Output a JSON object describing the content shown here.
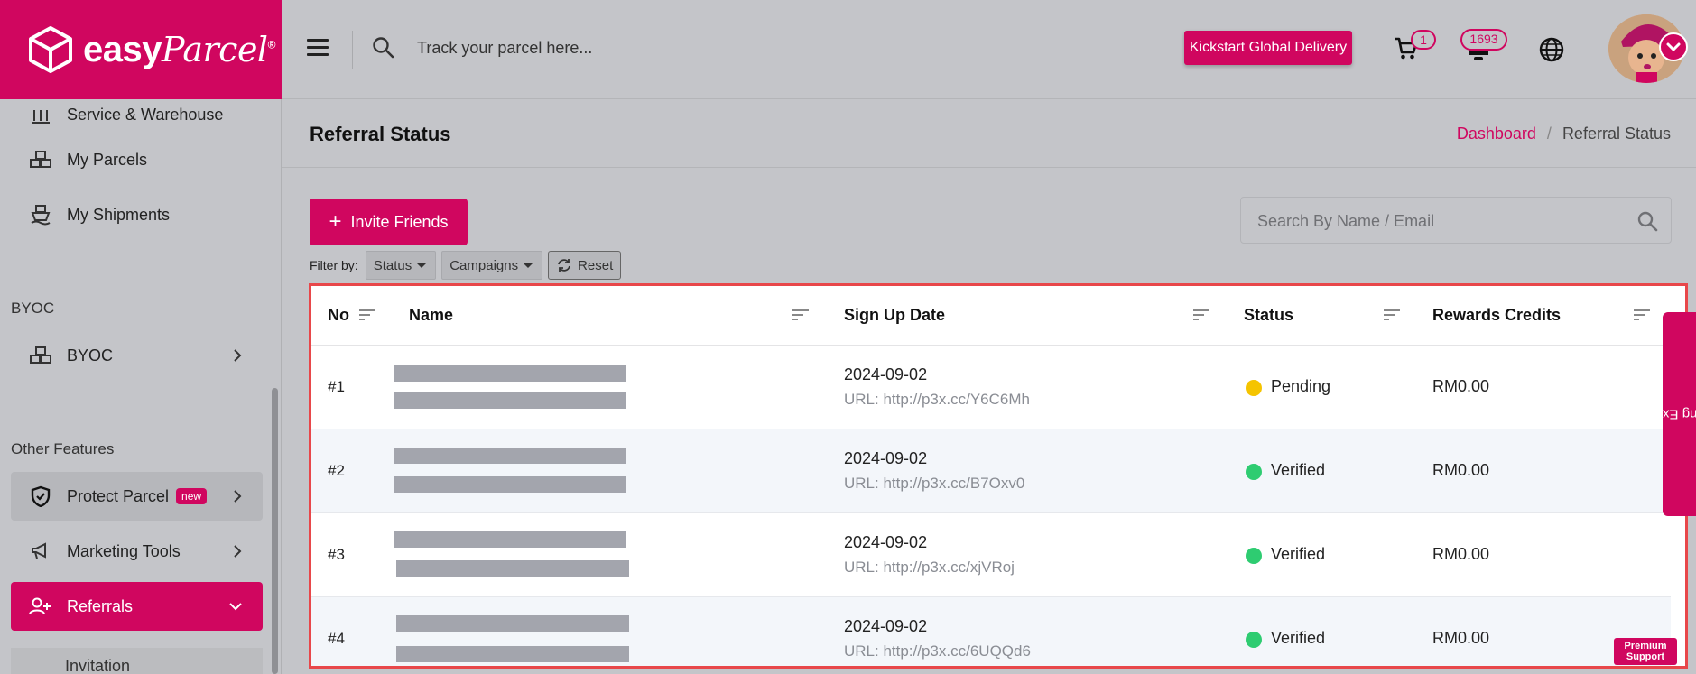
{
  "brand": {
    "name_bold": "easy",
    "name_script": "Parcel",
    "trademark": "®",
    "accent": "#d0065f"
  },
  "topbar": {
    "track_placeholder": "Track your parcel here...",
    "kickstart_label": "Kickstart Global Delivery",
    "cart_count": "1",
    "notification_count": "1693"
  },
  "sidebar": {
    "items_top": [
      {
        "label": "Service & Warehouse"
      },
      {
        "label": "My Parcels"
      },
      {
        "label": "My Shipments"
      }
    ],
    "section_byoc": "BYOC",
    "byoc_item": "BYOC",
    "section_other": "Other Features",
    "protect_parcel": "Protect Parcel",
    "protect_badge": "new",
    "marketing_tools": "Marketing Tools",
    "referrals": "Referrals",
    "invitation": "Invitation"
  },
  "page": {
    "title": "Referral Status",
    "breadcrumb": {
      "home": "Dashboard",
      "separator": "/",
      "current": "Referral Status"
    },
    "invite_label": "Invite Friends",
    "search_placeholder": "Search By Name / Email",
    "filter_label": "Filter by:",
    "filter_status": "Status",
    "filter_campaigns": "Campaigns",
    "reset_label": "Reset"
  },
  "table": {
    "headers": {
      "no": "No",
      "name": "Name",
      "signup": "Sign Up Date",
      "status": "Status",
      "rewards": "Rewards Credits"
    },
    "rows": [
      {
        "no": "#1",
        "date": "2024-09-02",
        "url": "URL: http://p3x.cc/Y6C6Mh",
        "status": "Pending",
        "status_color": "#f5c400",
        "credits": "RM0.00"
      },
      {
        "no": "#2",
        "date": "2024-09-02",
        "url": "URL: http://p3x.cc/B7Oxv0",
        "status": "Verified",
        "status_color": "#2ecc71",
        "credits": "RM0.00"
      },
      {
        "no": "#3",
        "date": "2024-09-02",
        "url": "URL: http://p3x.cc/xjVRoj",
        "status": "Verified",
        "status_color": "#2ecc71",
        "credits": "RM0.00"
      },
      {
        "no": "#4",
        "date": "2024-09-02",
        "url": "URL: http://p3x.cc/6UQQd6",
        "status": "Verified",
        "status_color": "#2ecc71",
        "credits": "RM0.00"
      }
    ]
  },
  "widgets": {
    "rate_tab": "Rate Booking Experience",
    "premium_line1": "Premium",
    "premium_line2": "Support"
  },
  "icons": [
    "cube-logo-icon",
    "hamburger-icon",
    "search-icon",
    "cart-icon",
    "bell-icon",
    "globe-icon",
    "chevron-down-icon",
    "warehouse-icon",
    "parcels-icon",
    "ship-icon",
    "shield-icon",
    "megaphone-icon",
    "user-add-icon",
    "sort-icon",
    "refresh-icon",
    "thumbs-up-icon"
  ]
}
